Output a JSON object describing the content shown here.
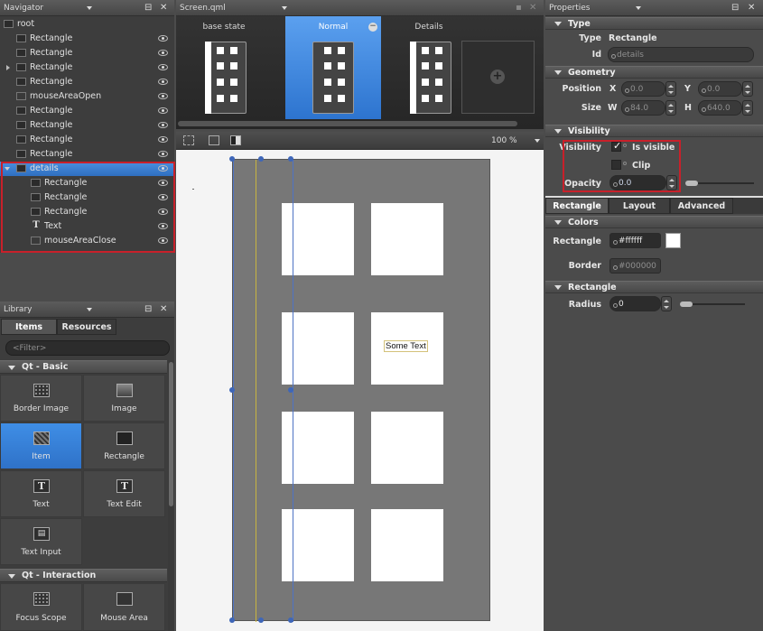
{
  "navigator": {
    "title": "Navigator",
    "items": [
      {
        "label": "root",
        "indent": 0,
        "icon": "rect",
        "eye": false
      },
      {
        "label": "Rectangle",
        "indent": 1,
        "icon": "rect",
        "eye": true
      },
      {
        "label": "Rectangle",
        "indent": 1,
        "icon": "rect",
        "eye": true
      },
      {
        "label": "Rectangle",
        "indent": 1,
        "icon": "rect",
        "eye": true,
        "expander": "closed"
      },
      {
        "label": "Rectangle",
        "indent": 1,
        "icon": "rect",
        "eye": true
      },
      {
        "label": "mouseAreaOpen",
        "indent": 1,
        "icon": "mouse",
        "eye": true
      },
      {
        "label": "Rectangle",
        "indent": 1,
        "icon": "rect",
        "eye": true
      },
      {
        "label": "Rectangle",
        "indent": 1,
        "icon": "rect",
        "eye": true
      },
      {
        "label": "Rectangle",
        "indent": 1,
        "icon": "rect",
        "eye": true
      },
      {
        "label": "Rectangle",
        "indent": 1,
        "icon": "rect",
        "eye": true
      },
      {
        "label": "details",
        "indent": 1,
        "icon": "rect",
        "eye": true,
        "selected": true,
        "expander": "open"
      },
      {
        "label": "Rectangle",
        "indent": 2,
        "icon": "rect",
        "eye": true
      },
      {
        "label": "Rectangle",
        "indent": 2,
        "icon": "rect",
        "eye": true
      },
      {
        "label": "Rectangle",
        "indent": 2,
        "icon": "rect",
        "eye": true
      },
      {
        "label": "Text",
        "indent": 2,
        "icon": "text",
        "eye": true
      },
      {
        "label": "mouseAreaClose",
        "indent": 2,
        "icon": "mouse",
        "eye": true
      }
    ]
  },
  "library": {
    "title": "Library",
    "tabs": [
      "Items",
      "Resources"
    ],
    "filter_placeholder": "<Filter>",
    "sections": [
      {
        "title": "Qt - Basic",
        "items": [
          "Border Image",
          "Image",
          "Item",
          "Rectangle",
          "Text",
          "Text Edit",
          "Text Input"
        ]
      },
      {
        "title": "Qt - Interaction",
        "items": [
          "Focus Scope",
          "Mouse Area"
        ]
      }
    ],
    "selected_item": "Item"
  },
  "editor": {
    "file_name": "Screen.qml",
    "states": [
      {
        "label": "base state",
        "selected": false
      },
      {
        "label": "Normal",
        "selected": true
      },
      {
        "label": "Details",
        "selected": false
      }
    ],
    "zoom": "100 %",
    "canvas_text": "Some Text"
  },
  "properties": {
    "title": "Properties",
    "type_group": "Type",
    "type_label": "Type",
    "type_value": "Rectangle",
    "id_label": "Id",
    "id_placeholder": "details",
    "geometry_group": "Geometry",
    "position_label": "Position",
    "x_label": "X",
    "x_value": "0.0",
    "y_label": "Y",
    "y_value": "0.0",
    "size_label": "Size",
    "w_label": "W",
    "w_value": "84.0",
    "h_label": "H",
    "h_value": "640.0",
    "visibility_group": "Visibility",
    "visibility_label": "Visibility",
    "is_visible_label": "Is visible",
    "clip_label": "Clip",
    "opacity_label": "Opacity",
    "opacity_value": "0.0",
    "tabs": [
      "Rectangle",
      "Layout",
      "Advanced"
    ],
    "colors_group": "Colors",
    "rect_color_label": "Rectangle",
    "rect_color_value": "#ffffff",
    "border_label": "Border",
    "border_placeholder": "#000000",
    "rectangle_group": "Rectangle",
    "radius_label": "Radius",
    "radius_value": "0"
  },
  "colors": {
    "selection": "#3a7fd6",
    "highlight_box": "#c8202a"
  }
}
